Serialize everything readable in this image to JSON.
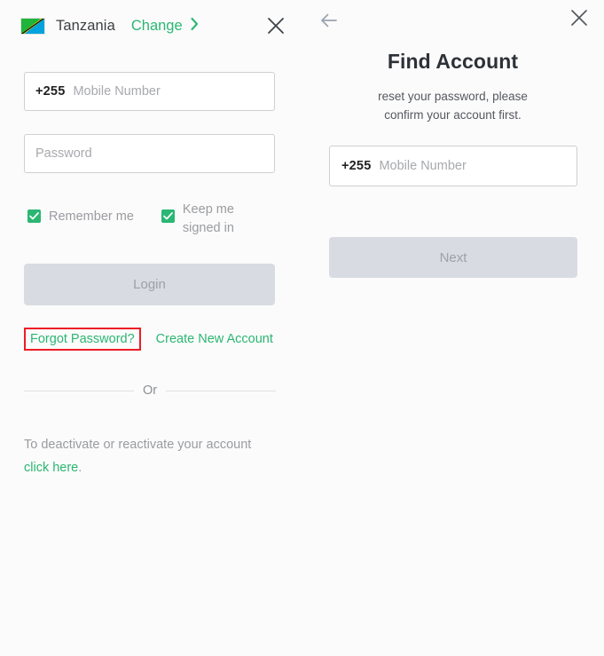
{
  "login": {
    "country": {
      "flag_icon": "tanzania-flag-icon",
      "name": "Tanzania",
      "change_label": "Change",
      "chevron_icon": "chevron-right-icon"
    },
    "close_icon": "close-icon",
    "mobile": {
      "country_code": "+255",
      "placeholder": "Mobile Number",
      "value": ""
    },
    "password": {
      "placeholder": "Password",
      "value": ""
    },
    "remember_me": {
      "label": "Remember me",
      "checked": true
    },
    "keep_signed_in": {
      "label": "Keep me signed in",
      "checked": true
    },
    "login_button": "Login",
    "forgot_password": "Forgot Password?",
    "create_account": "Create New Account",
    "divider_text": "Or",
    "deactivate_text": "To deactivate or reactivate your account",
    "deactivate_link": "click here",
    "deactivate_period": "."
  },
  "find_account": {
    "back_icon": "back-arrow-icon",
    "close_icon": "close-icon",
    "title": "Find Account",
    "subtitle": "reset your password, please confirm your account first.",
    "mobile": {
      "country_code": "+255",
      "placeholder": "Mobile Number",
      "value": ""
    },
    "next_button": "Next"
  },
  "colors": {
    "brand_green": "#2bb673",
    "highlight_red": "#ee1c25",
    "disabled_button": "#d8dbe2",
    "placeholder_gray": "#a7a9ad",
    "panel_background": "#fbfbfb"
  }
}
